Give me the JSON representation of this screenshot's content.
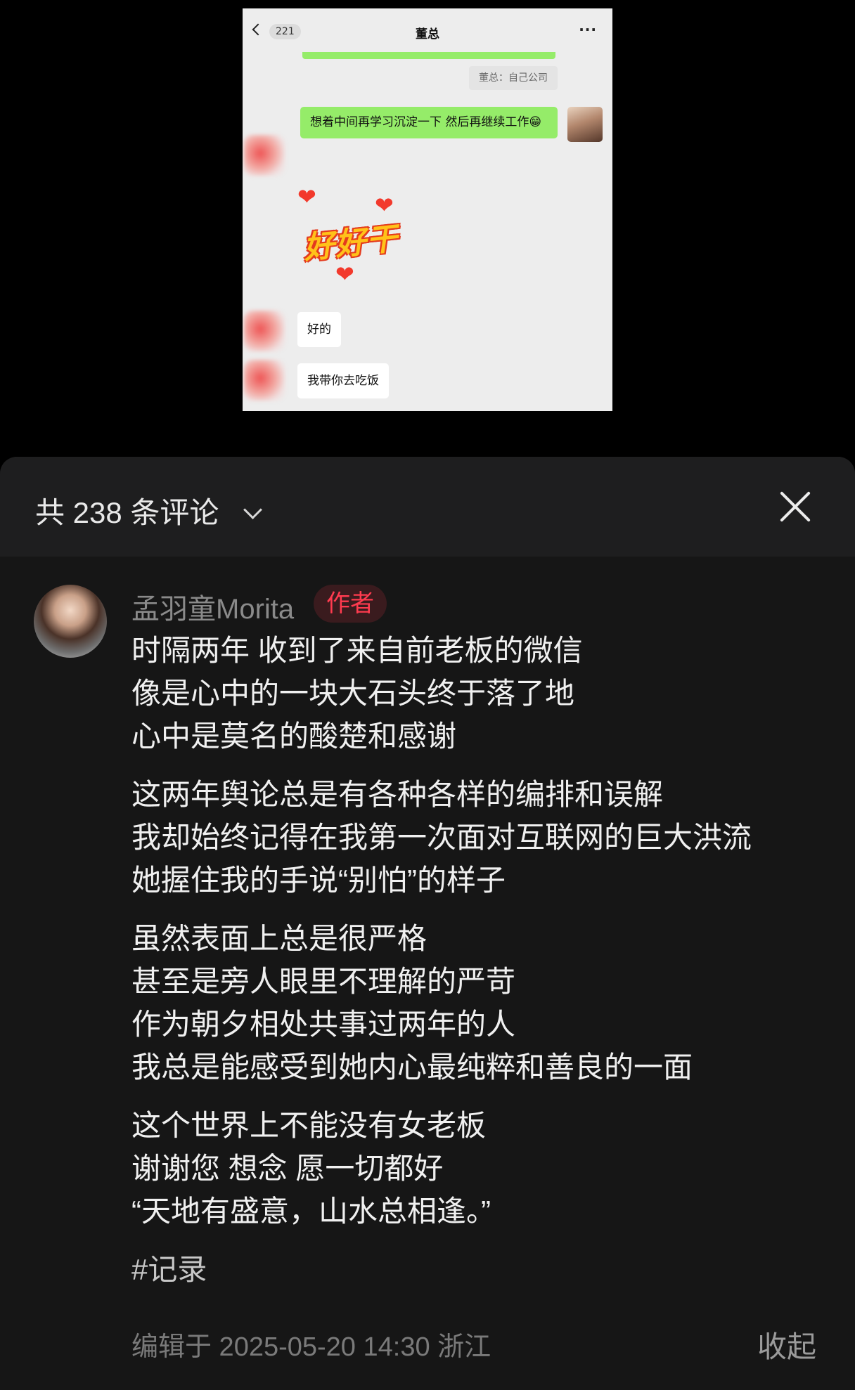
{
  "chat": {
    "unread_count": "221",
    "title": "董总",
    "more": "···",
    "quote": "董总：自己公司",
    "outgoing_message": "想着中间再学习沉淀一下 然后再继续工作😁",
    "sticker_text": "好好干",
    "incoming_messages": [
      "好的",
      "我带你去吃饭"
    ]
  },
  "comments_panel": {
    "count_label": "共 238 条评论",
    "comment": {
      "username": "孟羽童Morita",
      "badge": "作者",
      "paragraphs": [
        [
          "时隔两年 收到了来自前老板的微信",
          "像是心中的一块大石头终于落了地",
          "心中是莫名的酸楚和感谢"
        ],
        [
          "这两年舆论总是有各种各样的编排和误解",
          "我却始终记得在我第一次面对互联网的巨大洪流",
          "她握住我的手说“别怕”的样子"
        ],
        [
          "虽然表面上总是很严格",
          "甚至是旁人眼里不理解的严苛",
          "作为朝夕相处共事过两年的人",
          "我总是能感受到她内心最纯粹和善良的一面"
        ],
        [
          "这个世界上不能没有女老板",
          "谢谢您 想念 愿一切都好",
          "“天地有盛意，山水总相逢。”"
        ]
      ],
      "hashtag": "#记录",
      "meta": "编辑于 2025-05-20 14:30 浙江",
      "collapse_label": "收起"
    }
  }
}
